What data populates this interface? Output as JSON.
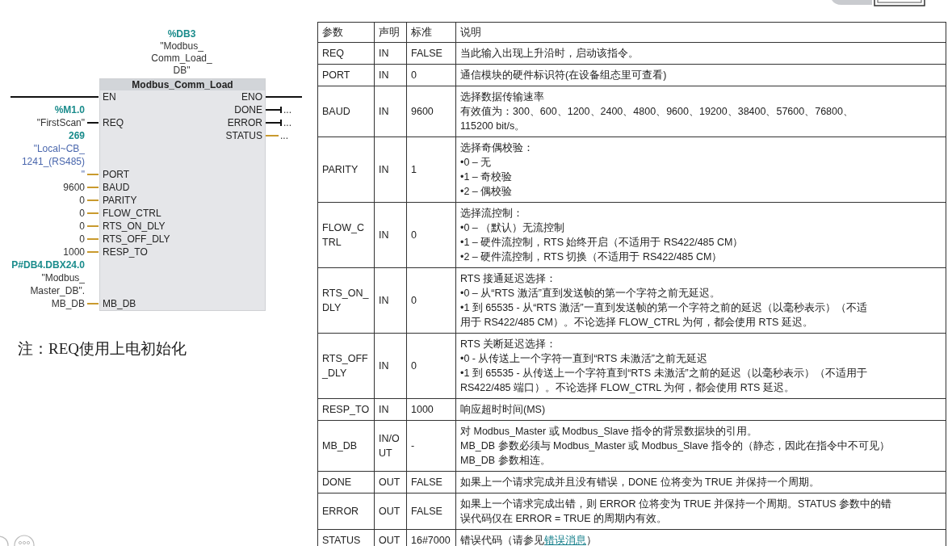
{
  "diagram": {
    "instance": {
      "address": "%DB3",
      "name": [
        "\"Modbus_",
        "Comm_Load_",
        "DB\""
      ]
    },
    "title": "Modbus_Comm_Load",
    "inputs": [
      {
        "pin": "EN",
        "kind": "power"
      },
      {
        "pin": "REQ",
        "kind": "bool",
        "address": "%M1.0",
        "operand": [
          "\"FirstScan\""
        ]
      },
      {
        "pin": "PORT",
        "kind": "hw",
        "address": "269",
        "operand": [
          "\"Local~CB_",
          "1241_(RS485)",
          "\""
        ]
      },
      {
        "pin": "BAUD",
        "kind": "word",
        "operand": [
          "9600"
        ]
      },
      {
        "pin": "PARITY",
        "kind": "word",
        "operand": [
          "0"
        ]
      },
      {
        "pin": "FLOW_CTRL",
        "kind": "word",
        "operand": [
          "0"
        ]
      },
      {
        "pin": "RTS_ON_DLY",
        "kind": "word",
        "operand": [
          "0"
        ]
      },
      {
        "pin": "RTS_OFF_DLY",
        "kind": "word",
        "operand": [
          "0"
        ]
      },
      {
        "pin": "RESP_TO",
        "kind": "word",
        "operand": [
          "1000"
        ]
      },
      {
        "pin": "MB_DB",
        "kind": "word",
        "address": "P#DB4.DBX24.0",
        "operand": [
          "\"Modbus_",
          "Master_DB\".",
          "MB_DB"
        ]
      }
    ],
    "outputs": [
      {
        "pin": "ENO",
        "kind": "power"
      },
      {
        "pin": "DONE",
        "kind": "bool",
        "operand": "..."
      },
      {
        "pin": "ERROR",
        "kind": "bool",
        "operand": "..."
      },
      {
        "pin": "STATUS",
        "kind": "word",
        "operand": "..."
      }
    ]
  },
  "note": "注：REQ使用上电初始化",
  "table": {
    "columns": [
      "参数",
      "声明",
      "标准",
      "说明"
    ],
    "rows": [
      {
        "parameter": "REQ",
        "declaration": "IN",
        "default": "FALSE",
        "description": [
          "当此输入出现上升沿时，启动该指令。"
        ]
      },
      {
        "parameter": "PORT",
        "declaration": "IN",
        "default": "0",
        "description": [
          "通信模块的硬件标识符(在设备组态里可查看)"
        ]
      },
      {
        "parameter": "BAUD",
        "declaration": "IN",
        "default": "9600",
        "description": [
          "选择数据传输速率",
          "有效值为：300、600、1200、2400、4800、9600、19200、38400、57600、76800、",
          "115200 bit/s。"
        ]
      },
      {
        "parameter": "PARITY",
        "declaration": "IN",
        "default": "1",
        "description": [
          "选择奇偶校验：",
          "•0 – 无",
          "•1 – 奇校验",
          "•2 – 偶校验"
        ]
      },
      {
        "parameter": "FLOW_CTRL",
        "declaration": "IN",
        "default": "0",
        "description": [
          "选择流控制：",
          "•0 – （默认）无流控制",
          "•1 – 硬件流控制，RTS 始终开启（不适用于 RS422/485 CM）",
          "•2 – 硬件流控制，RTS 切换（不适用于 RS422/485 CM）"
        ]
      },
      {
        "parameter": "RTS_ON_DLY",
        "declaration": "IN",
        "default": "0",
        "description": [
          "RTS 接通延迟选择：",
          "•0 – 从“RTS 激活”直到发送帧的第一个字符之前无延迟。",
          "•1 到 65535 - 从“RTS 激活”一直到发送帧的第一个字符之前的延迟（以毫秒表示）（不适",
          "用于 RS422/485 CM）。不论选择 FLOW_CTRL 为何，都会使用 RTS 延迟。"
        ]
      },
      {
        "parameter": "RTS_OFF_DLY",
        "declaration": "IN",
        "default": "0",
        "description": [
          "RTS 关断延迟选择：",
          "•0 - 从传送上一个字符一直到“RTS 未激活”之前无延迟",
          "•1 到 65535 - 从传送上一个字符直到“RTS 未激活”之前的延迟（以毫秒表示）（不适用于",
          "RS422/485 端口）。不论选择 FLOW_CTRL 为何，都会使用 RTS 延迟。"
        ]
      },
      {
        "parameter": "RESP_TO",
        "declaration": "IN",
        "default": "1000",
        "description": [
          "响应超时时间(MS)"
        ]
      },
      {
        "parameter": "MB_DB",
        "declaration": "IN/OUT",
        "default": "-",
        "description": [
          "对 Modbus_Master 或 Modbus_Slave 指令的背景数据块的引用。",
          "MB_DB 参数必须与 Modbus_Master 或 Modbus_Slave 指令的（静态，因此在指令中不可见）",
          "MB_DB 参数相连。"
        ]
      },
      {
        "parameter": "DONE",
        "declaration": "OUT",
        "default": "FALSE",
        "description": [
          "如果上一个请求完成并且没有错误，DONE 位将变为 TRUE 并保持一个周期。"
        ]
      },
      {
        "parameter": "ERROR",
        "declaration": "OUT",
        "default": "FALSE",
        "description": [
          "如果上一个请求完成出错，则 ERROR 位将变为 TRUE 并保持一个周期。STATUS 参数中的错",
          "误代码仅在 ERROR = TRUE 的周期内有效。"
        ]
      },
      {
        "parameter": "STATUS",
        "declaration": "OUT",
        "default": "16#7000",
        "description": [
          "错误代码（请参见"
        ],
        "link": "错误消息",
        "link_after": "）"
      }
    ]
  }
}
